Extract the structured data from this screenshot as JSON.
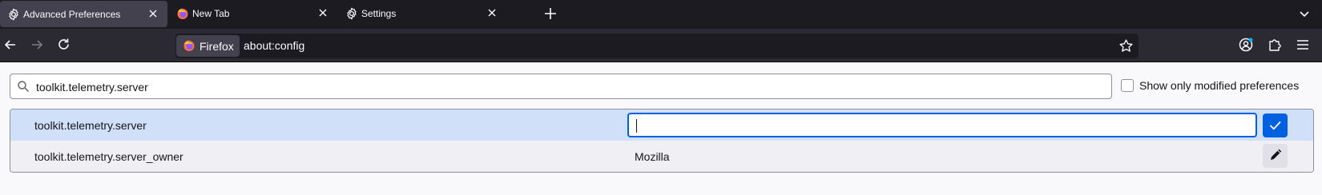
{
  "colors": {
    "tabbar_bg": "#1c1b22",
    "toolbar_bg": "#2b2a33",
    "accent": "#0061e0",
    "selected_row": "#cfe0f8"
  },
  "tabs": [
    {
      "label": "Advanced Preferences",
      "icon": "gear-icon",
      "active": true
    },
    {
      "label": "New Tab",
      "icon": "firefox-icon",
      "active": false
    },
    {
      "label": "Settings",
      "icon": "gear-icon",
      "active": false
    }
  ],
  "urlbar": {
    "identity_label": "Firefox",
    "url": "about:config"
  },
  "config": {
    "search_value": "toolkit.telemetry.server",
    "show_modified_label": "Show only modified preferences",
    "show_modified_checked": false,
    "rows": [
      {
        "name": "toolkit.telemetry.server",
        "value": "",
        "editing": true
      },
      {
        "name": "toolkit.telemetry.server_owner",
        "value": "Mozilla",
        "editing": false
      }
    ]
  }
}
